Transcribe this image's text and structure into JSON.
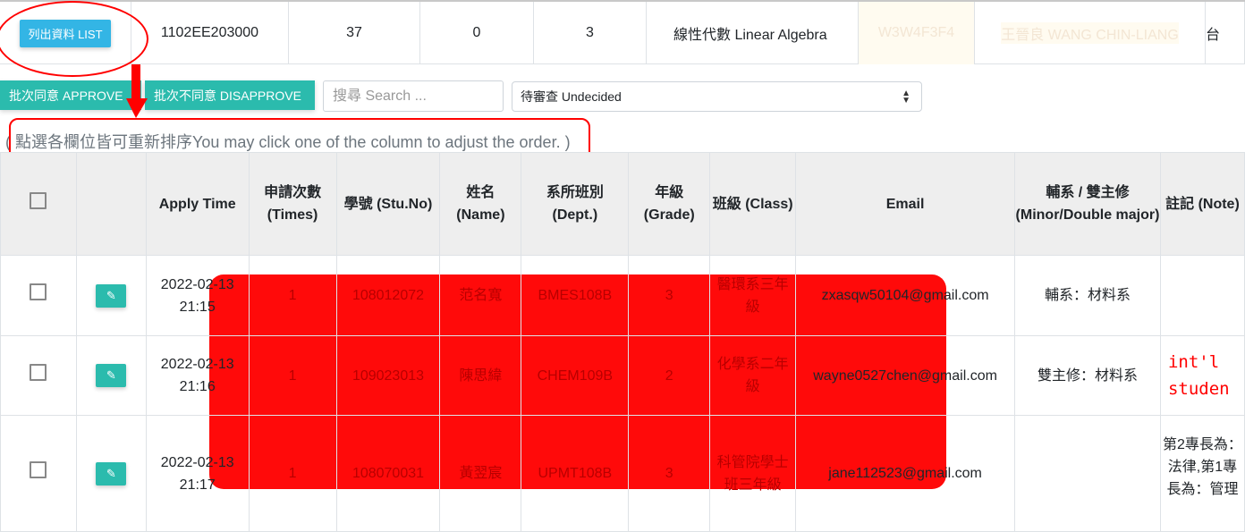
{
  "course_row": {
    "list_button": "列出資料 LIST",
    "course_code": "1102EE203000",
    "c1": "37",
    "c2": "0",
    "c3": "3",
    "course_name": "線性代數 Linear Algebra",
    "time": "W3W4F3F4",
    "teacher": "王晉良 WANG CHIN-LIANG",
    "extra": "台"
  },
  "toolbar": {
    "approve": "批次同意 APPROVE",
    "disapprove": "批次不同意 DISAPPROVE",
    "search_placeholder": "搜尋 Search ...",
    "filter_value": "待審查 Undecided"
  },
  "hint": "( 點選各欄位皆可重新排序You may click one of the column to adjust the order. )",
  "headers": [
    "Apply Time",
    "申請次數 (Times)",
    "學號 (Stu.No)",
    "姓名 (Name)",
    "系所班別 (Dept.)",
    "年級 (Grade)",
    "班級 (Class)",
    "Email",
    "輔系 / 雙主修 (Minor/Double major)",
    "註記 (Note)"
  ],
  "rows": [
    {
      "apply_time": "2022-02-13 21:15",
      "times": "1",
      "stu_no": "108012072",
      "name": "范名寬",
      "dept": "BMES108B",
      "grade": "3",
      "class": "醫環系三年級",
      "email": "zxasqw50104@gmail.com",
      "minor": "輔系：材料系",
      "note": ""
    },
    {
      "apply_time": "2022-02-13 21:16",
      "times": "1",
      "stu_no": "109023013",
      "name": "陳思緯",
      "dept": "CHEM109B",
      "grade": "2",
      "class": "化學系二年級",
      "email": "wayne0527chen@gmail.com",
      "minor": "雙主修：材料系",
      "note": "int'l studen"
    },
    {
      "apply_time": "2022-02-13 21:17",
      "times": "1",
      "stu_no": "108070031",
      "name": "黃翌宸",
      "dept": "UPMT108B",
      "grade": "3",
      "class": "科管院學士班三年級",
      "email": "jane112523@gmail.com",
      "minor": "",
      "note": "第2專長為：法律,第1專長為：管理"
    }
  ],
  "colors": {
    "accent": "#2bbbad",
    "list_button": "#33b5e5",
    "annotation": "#ff0000"
  },
  "icons": {
    "edit": "pencil-icon",
    "select": "sort-arrows-icon"
  }
}
